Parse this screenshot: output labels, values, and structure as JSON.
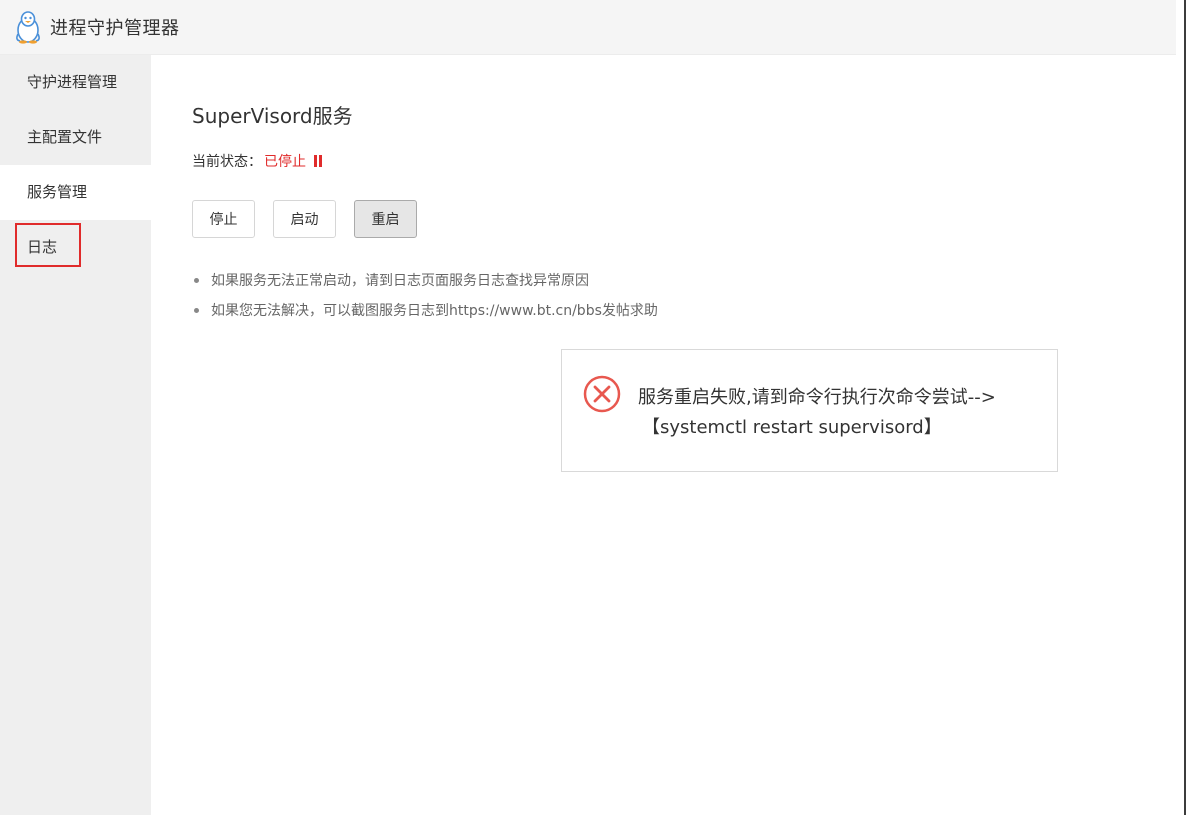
{
  "window": {
    "title": "进程守护管理器"
  },
  "sidebar": {
    "items": [
      {
        "label": "守护进程管理"
      },
      {
        "label": "主配置文件"
      },
      {
        "label": "服务管理"
      },
      {
        "label": "日志"
      }
    ],
    "active_index": 2,
    "highlighted_index": 3
  },
  "main": {
    "service_title": "SuperVisord服务",
    "status_label": "当前状态：",
    "status_value": "已停止",
    "status_color": "#e02b2b",
    "buttons": {
      "stop": "停止",
      "start": "启动",
      "restart": "重启"
    },
    "tips": [
      "如果服务无法正常启动，请到日志页面服务日志查找异常原因",
      "如果您无法解决，可以截图服务日志到https://www.bt.cn/bbs发帖求助"
    ]
  },
  "toast": {
    "message": "服务重启失败,请到命令行执行次命令尝试-->",
    "command": "【systemctl restart supervisord】",
    "icon": "error-circle-icon",
    "icon_color": "#e8584f"
  }
}
